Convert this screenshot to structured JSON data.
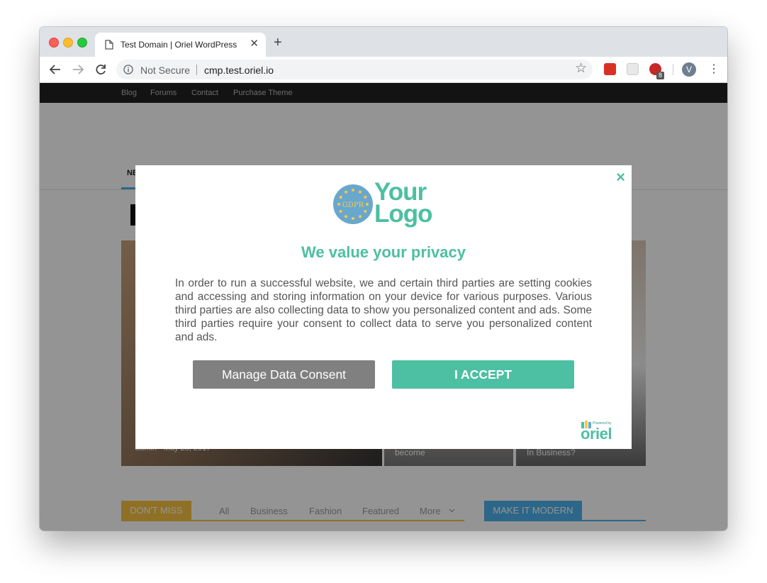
{
  "browser": {
    "tab": {
      "title": "Test Domain | Oriel WordPress",
      "close": "✕"
    },
    "new_tab": "+",
    "toolbar": {
      "security_label": "Not Secure",
      "url": "cmp.test.oriel.io",
      "star": "☆",
      "ext_badge": "8",
      "avatar_initial": "V",
      "menu": "⋮"
    }
  },
  "website": {
    "topnav": [
      "Blog",
      "Forums",
      "Contact",
      "Purchase Theme"
    ],
    "nav_item": "NE",
    "featured": {
      "meta": "admin - May 23, 2017",
      "item2_title": "become",
      "item3_title": "In Business?"
    },
    "dont_miss": {
      "label": "DON'T MISS",
      "filters": [
        "All",
        "Business",
        "Fashion",
        "Featured",
        "More"
      ]
    },
    "modern_label": "MAKE IT MODERN"
  },
  "modal": {
    "close": "×",
    "logo": {
      "badge": "GDPR",
      "line1": "Your",
      "line2": "Logo"
    },
    "headline": "We value your privacy",
    "body": "In order to run a successful website, we and certain third parties are setting cookies and accessing and storing information on your device for various purposes. Various third parties are also collecting data to show you personalized content and ads. Some third parties require your consent to collect data to serve you personalized content and ads.",
    "manage_button": "Manage Data Consent",
    "accept_button": "I ACCEPT",
    "powered_by": {
      "small": "Powered by",
      "name": "oriel"
    }
  },
  "colors": {
    "accent": "#4dbfa2",
    "manage": "#808080",
    "gdpr_badge": "#6aa7cd"
  }
}
